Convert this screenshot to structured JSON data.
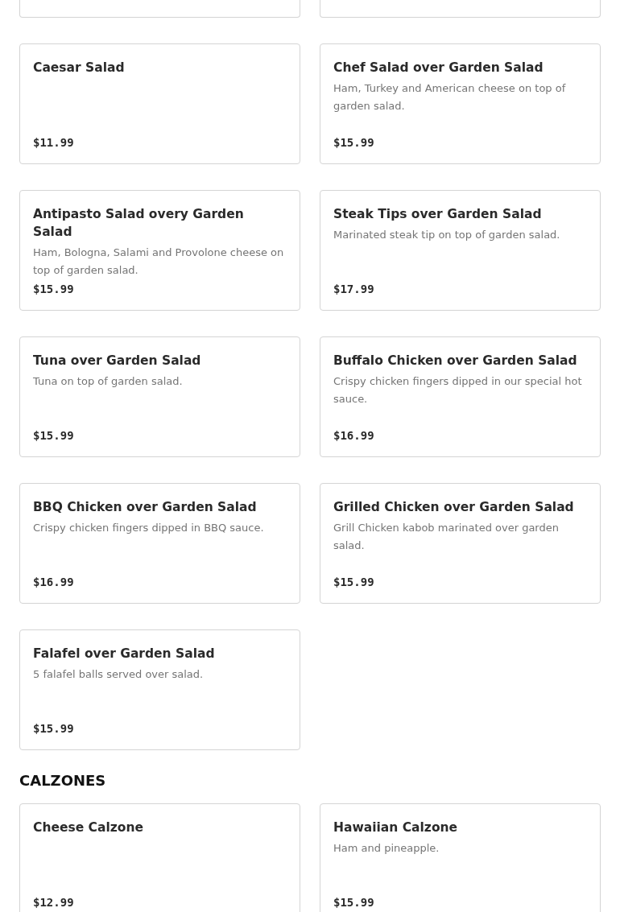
{
  "sections": [
    {
      "items": [
        {
          "name": "Caesar Salad",
          "price": "$11.99"
        },
        {
          "name": "Chef Salad over Garden Salad",
          "description": "Ham, Turkey and American cheese on top of garden salad.",
          "price": "$15.99"
        },
        {
          "name": "Antipasto Salad overy Garden Salad",
          "description": "Ham, Bologna, Salami and Provolone cheese on top of garden salad.",
          "price": "$15.99"
        },
        {
          "name": "Steak Tips over Garden Salad",
          "description": "Marinated steak tip on top of garden salad.",
          "price": "$17.99"
        },
        {
          "name": "Tuna over Garden Salad",
          "description": "Tuna on top of garden salad.",
          "price": "$15.99"
        },
        {
          "name": "Buffalo Chicken over Garden Salad",
          "description": "Crispy chicken fingers dipped in our special hot sauce.",
          "price": "$16.99"
        },
        {
          "name": "BBQ Chicken over Garden Salad",
          "description": "Crispy chicken fingers dipped in BBQ sauce.",
          "price": "$16.99"
        },
        {
          "name": "Grilled Chicken over Garden Salad",
          "description": "Grill Chicken kabob marinated over garden salad.",
          "price": "$15.99"
        },
        {
          "name": "Falafel over Garden Salad",
          "description": "5 falafel balls served over salad.",
          "price": "$15.99"
        }
      ]
    },
    {
      "title": "CALZONES",
      "items": [
        {
          "name": "Cheese Calzone",
          "price": "$12.99"
        },
        {
          "name": "Hawaiian Calzone",
          "description": "Ham and pineapple.",
          "price": "$15.99"
        }
      ]
    }
  ]
}
